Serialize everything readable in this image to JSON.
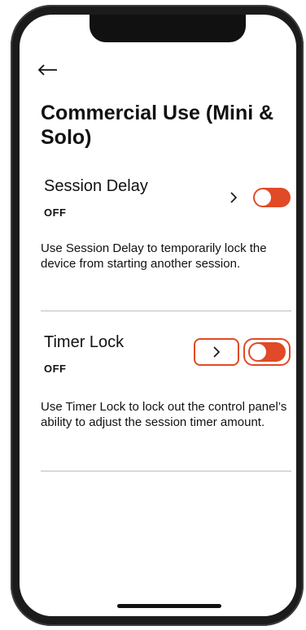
{
  "header": {
    "back_icon": "left-arrow-icon",
    "title": "Commercial Use (Mini & Solo)"
  },
  "settings": [
    {
      "name": "Session Delay",
      "status": "OFF",
      "description": "Use Session Delay to temporarily lock the device from starting another session.",
      "toggle_on": false
    },
    {
      "name": "Timer Lock",
      "status": "OFF",
      "description": "Use Timer Lock to lock out the control panel’s ability to adjust the session timer amount.",
      "toggle_on": false
    }
  ],
  "colors": {
    "accent": "#e04a26",
    "text": "#111111",
    "divider": "#bdbdbd"
  }
}
